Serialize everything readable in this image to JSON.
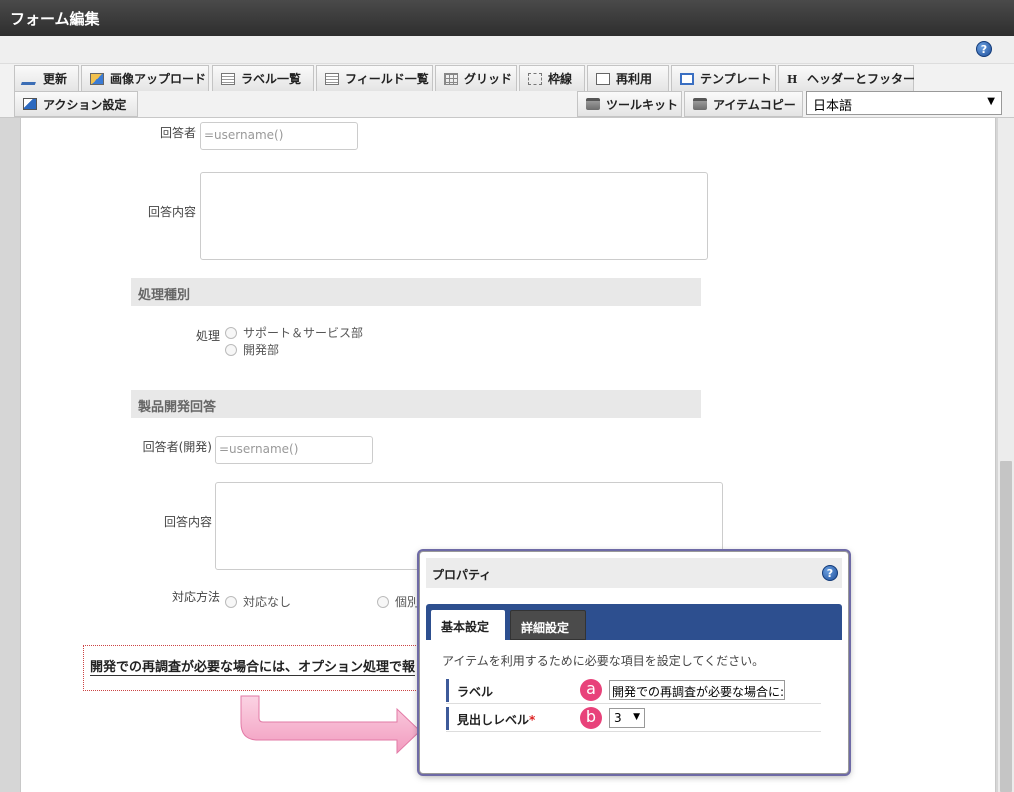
{
  "window": {
    "title": "フォーム編集"
  },
  "toolbar": {
    "row1": [
      {
        "label": "更新",
        "icon": "update-icon"
      },
      {
        "label": "画像アップロード",
        "icon": "image-upload-icon"
      },
      {
        "label": "ラベル一覧",
        "icon": "label-list-icon"
      },
      {
        "label": "フィールド一覧",
        "icon": "field-list-icon"
      },
      {
        "label": "グリッド",
        "icon": "grid-icon"
      },
      {
        "label": "枠線",
        "icon": "border-icon"
      },
      {
        "label": "再利用",
        "icon": "reuse-icon"
      },
      {
        "label": "テンプレート",
        "icon": "template-icon"
      },
      {
        "label": "ヘッダーとフッター",
        "icon": "header-footer-icon"
      }
    ],
    "action_label": "アクション設定",
    "toolkit_label": "ツールキット",
    "item_copy_label": "アイテムコピー",
    "language": "日本語"
  },
  "form": {
    "respondent_label": "回答者",
    "respondent_value": "=username()",
    "response_label": "回答内容",
    "process_section": "処理種別",
    "process_label": "処理",
    "process_options": [
      "サポート＆サービス部",
      "開発部"
    ],
    "dev_section": "製品開発回答",
    "dev_respondent_label": "回答者(開発)",
    "dev_respondent_value": "=username()",
    "dev_response_label": "回答内容",
    "method_label": "対応方法",
    "method_options": [
      "対応なし",
      "個別"
    ],
    "heading_text": "開発での再調査が必要な場合には、オプション処理で報"
  },
  "dialog": {
    "title": "プロパティ",
    "tabs": [
      "基本設定",
      "詳細設定"
    ],
    "description": "アイテムを利用するために必要な項目を設定してください。",
    "rows": [
      {
        "name": "ラベル",
        "badge": "a",
        "value": "開発での再調査が必要な場合に:"
      },
      {
        "name": "見出しレベル",
        "required_mark": "*",
        "badge": "b",
        "value": "3"
      }
    ]
  },
  "colors": {
    "accent_pink": "#e8427a",
    "tab_bar": "#2d4f8f",
    "title_bar": "#2e2e2e"
  }
}
